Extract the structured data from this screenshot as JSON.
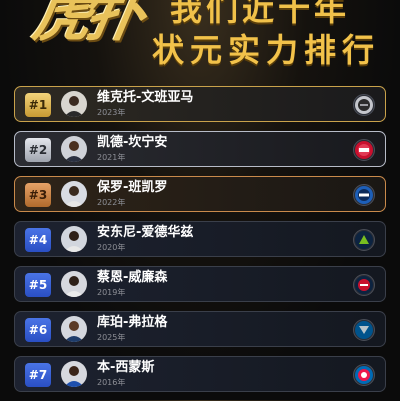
{
  "header": {
    "logo_text": "虎扑",
    "title_line1": "我们近十年",
    "title_line2": "状元实力排行"
  },
  "rankings": [
    {
      "rank": "#1",
      "name": "维克托-文班亚马",
      "year": "2023年",
      "team_icon": "spurs-logo-icon",
      "tier": "gold"
    },
    {
      "rank": "#2",
      "name": "凯德-坎宁安",
      "year": "2021年",
      "team_icon": "pistons-logo-icon",
      "tier": "silver"
    },
    {
      "rank": "#3",
      "name": "保罗-班凯罗",
      "year": "2022年",
      "team_icon": "magic-logo-icon",
      "tier": "bronze"
    },
    {
      "rank": "#4",
      "name": "安东尼-爱德华兹",
      "year": "2020年",
      "team_icon": "timberwolves-logo-icon",
      "tier": "blue"
    },
    {
      "rank": "#5",
      "name": "蔡恩-威廉森",
      "year": "2019年",
      "team_icon": "pelicans-logo-icon",
      "tier": "blue"
    },
    {
      "rank": "#6",
      "name": "库珀-弗拉格",
      "year": "2025年",
      "team_icon": "mavericks-logo-icon",
      "tier": "blue"
    },
    {
      "rank": "#7",
      "name": "本-西蒙斯",
      "year": "2016年",
      "team_icon": "76ers-logo-icon",
      "tier": "blue"
    }
  ],
  "colors": {
    "gold": "#c9a24b",
    "silver": "#b7bcc8",
    "bronze": "#c98a4b",
    "blue": "#3a62d8",
    "title": "#f0c14a"
  }
}
